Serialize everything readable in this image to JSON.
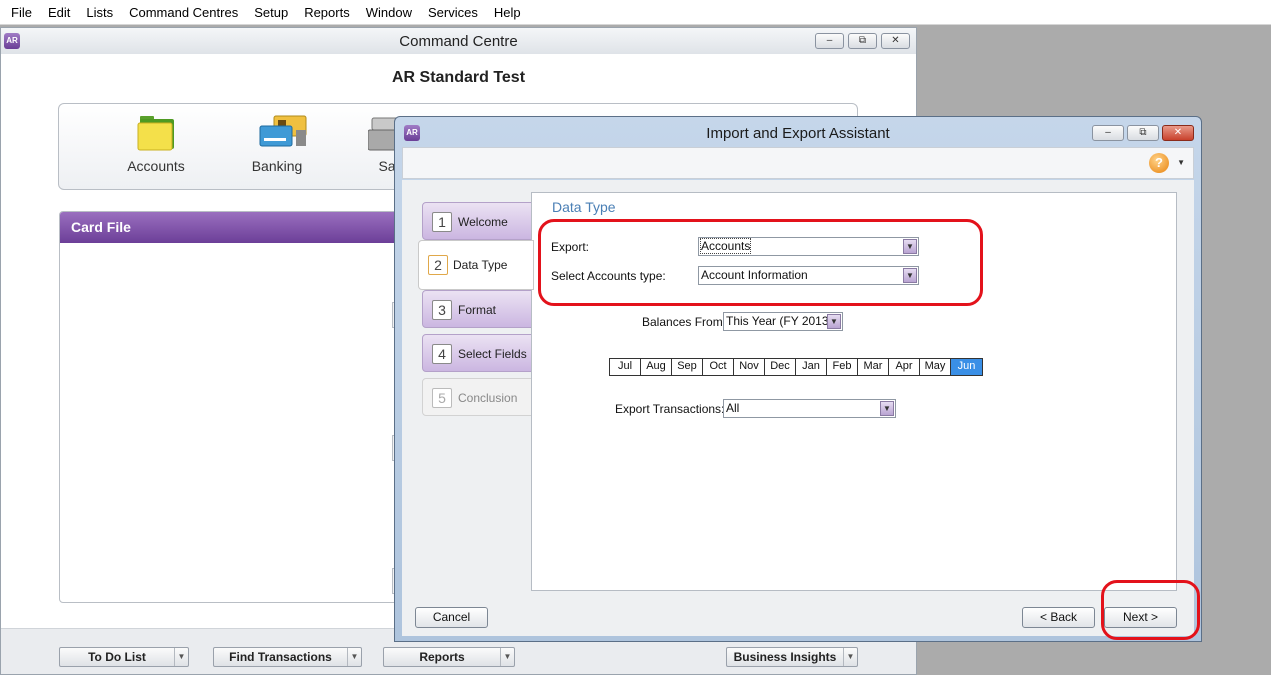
{
  "menubar": {
    "items": [
      "File",
      "Edit",
      "Lists",
      "Command Centres",
      "Setup",
      "Reports",
      "Window",
      "Services",
      "Help"
    ]
  },
  "app_badge": "AR",
  "command_centre": {
    "title": "Command Centre",
    "company": "AR Standard Test",
    "icons": [
      {
        "label": "Accounts",
        "icon": "folder-icon"
      },
      {
        "label": "Banking",
        "icon": "bank-cards-icon"
      },
      {
        "label": "Sa",
        "icon": "cash-register-icon"
      }
    ],
    "card_file_title": "Card File",
    "bottom_buttons": [
      "To Do List",
      "Find Transactions",
      "Reports",
      "Business Insights"
    ]
  },
  "assistant": {
    "title": "Import and Export Assistant",
    "steps": [
      {
        "num": "1",
        "label": "Welcome",
        "state": "normal"
      },
      {
        "num": "2",
        "label": "Data Type",
        "state": "active"
      },
      {
        "num": "3",
        "label": "Format",
        "state": "normal"
      },
      {
        "num": "4",
        "label": "Select Fields",
        "state": "normal"
      },
      {
        "num": "5",
        "label": "Conclusion",
        "state": "disabled"
      }
    ],
    "section_title": "Data Type",
    "export_label": "Export:",
    "export_value": "Accounts",
    "accounts_type_label": "Select Accounts type:",
    "accounts_type_value": "Account Information",
    "balances_label": "Balances From:",
    "balances_value": "This Year (FY 2013)",
    "months": [
      "Jul",
      "Aug",
      "Sep",
      "Oct",
      "Nov",
      "Dec",
      "Jan",
      "Feb",
      "Mar",
      "Apr",
      "May",
      "Jun"
    ],
    "selected_month": "Jun",
    "transactions_label": "Export Transactions:",
    "transactions_value": "All",
    "cancel_label": "Cancel",
    "back_label": "< Back",
    "next_label": "Next >",
    "help_glyph": "?"
  },
  "colors": {
    "highlight": "#e3121b",
    "accent_purple": "#6c3f98",
    "selected_month": "#3a8fe6",
    "section_title": "#4a7fb5"
  }
}
